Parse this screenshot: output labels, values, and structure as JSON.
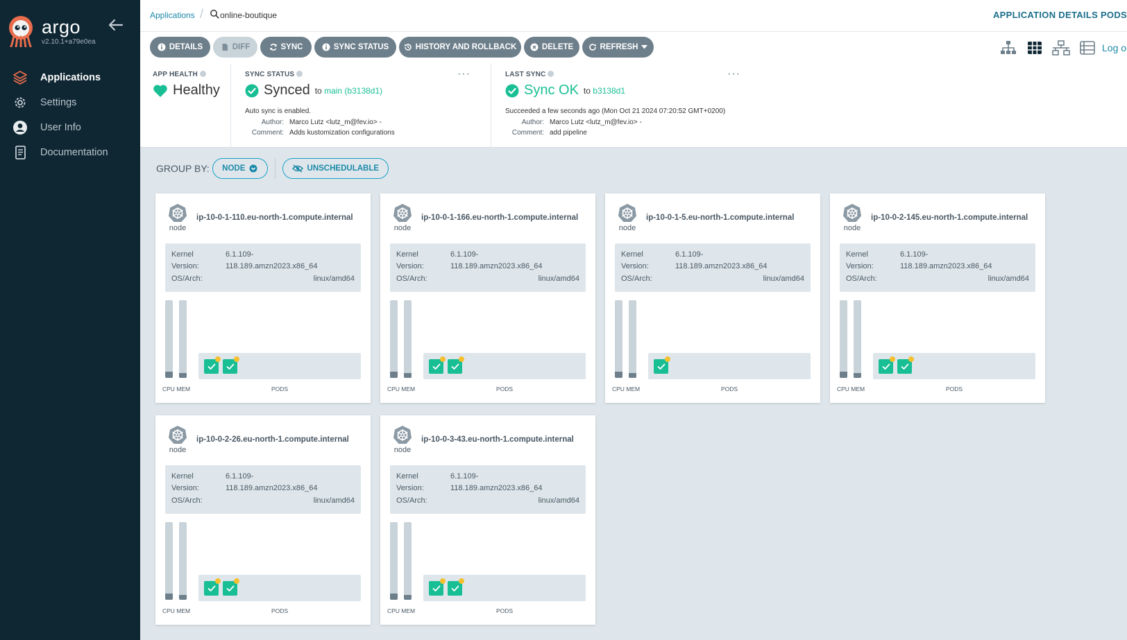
{
  "sidebar": {
    "brand": "argo",
    "version": "v2.10.1+a79e0ea",
    "items": [
      {
        "label": "Applications",
        "active": true
      },
      {
        "label": "Settings",
        "active": false
      },
      {
        "label": "User Info",
        "active": false
      },
      {
        "label": "Documentation",
        "active": false
      }
    ]
  },
  "topbar": {
    "breadcrumb": "Applications",
    "app_name": "online-boutique",
    "right_title": "APPLICATION DETAILS PODS"
  },
  "toolbar": {
    "details": "DETAILS",
    "diff": "DIFF",
    "sync": "SYNC",
    "sync_status": "SYNC STATUS",
    "history": "HISTORY AND ROLLBACK",
    "delete": "DELETE",
    "refresh": "REFRESH",
    "log_link": "Log out"
  },
  "status": {
    "app_health": {
      "title": "APP HEALTH",
      "value": "Healthy"
    },
    "sync_status": {
      "title": "SYNC STATUS",
      "value": "Synced",
      "to_prefix": "to",
      "to_target": "main (b3138d1)",
      "auto_sync": "Auto sync is enabled.",
      "author_label": "Author:",
      "author": "Marco Lutz <lutz_m@fev.io> -",
      "comment_label": "Comment:",
      "comment": "Adds kustomization configurations"
    },
    "last_sync": {
      "title": "LAST SYNC",
      "value": "Sync OK",
      "to_prefix": "to",
      "to_target": "b3138d1",
      "succeeded": "Succeeded a few seconds ago (Mon Oct 21 2024 07:20:52 GMT+0200)",
      "author_label": "Author:",
      "author": "Marco Lutz <lutz_m@fev.io> -",
      "comment_label": "Comment:",
      "comment": "add pipeline"
    },
    "more": "···"
  },
  "groupby": {
    "label": "GROUP BY:",
    "node": "NODE",
    "unschedulable": "UNSCHEDULABLE"
  },
  "nodes": [
    {
      "name": "ip-10-0-1-110.eu-north-1.compute.internal",
      "label": "node",
      "kernel_label": "Kernel",
      "kernel": "6.1.109-",
      "version_label": "Version:",
      "version": "118.189.amzn2023.x86_64",
      "osarch_label": "OS/Arch:",
      "osarch": "linux/amd64",
      "cpu_label": "CPU MEM",
      "pods_label": "PODS",
      "pods": 2,
      "cpu": 0.08,
      "mem": 0.0
    },
    {
      "name": "ip-10-0-1-166.eu-north-1.compute.internal",
      "label": "node",
      "kernel_label": "Kernel",
      "kernel": "6.1.109-",
      "version_label": "Version:",
      "version": "118.189.amzn2023.x86_64",
      "osarch_label": "OS/Arch:",
      "osarch": "linux/amd64",
      "cpu_label": "CPU MEM",
      "pods_label": "PODS",
      "pods": 2,
      "cpu": 0.08,
      "mem": 0.0
    },
    {
      "name": "ip-10-0-1-5.eu-north-1.compute.internal",
      "label": "node",
      "kernel_label": "Kernel",
      "kernel": "6.1.109-",
      "version_label": "Version:",
      "version": "118.189.amzn2023.x86_64",
      "osarch_label": "OS/Arch:",
      "osarch": "linux/amd64",
      "cpu_label": "CPU MEM",
      "pods_label": "PODS",
      "pods": 1,
      "cpu": 0.08,
      "mem": 0.0
    },
    {
      "name": "ip-10-0-2-145.eu-north-1.compute.internal",
      "label": "node",
      "kernel_label": "Kernel",
      "kernel": "6.1.109-",
      "version_label": "Version:",
      "version": "118.189.amzn2023.x86_64",
      "osarch_label": "OS/Arch:",
      "osarch": "linux/amd64",
      "cpu_label": "CPU MEM",
      "pods_label": "PODS",
      "pods": 2,
      "cpu": 0.08,
      "mem": 0.0
    },
    {
      "name": "ip-10-0-2-26.eu-north-1.compute.internal",
      "label": "node",
      "kernel_label": "Kernel",
      "kernel": "6.1.109-",
      "version_label": "Version:",
      "version": "118.189.amzn2023.x86_64",
      "osarch_label": "OS/Arch:",
      "osarch": "linux/amd64",
      "cpu_label": "CPU MEM",
      "pods_label": "PODS",
      "pods": 2,
      "cpu": 0.08,
      "mem": 0.0
    },
    {
      "name": "ip-10-0-3-43.eu-north-1.compute.internal",
      "label": "node",
      "kernel_label": "Kernel",
      "kernel": "6.1.109-",
      "version_label": "Version:",
      "version": "118.189.amzn2023.x86_64",
      "osarch_label": "OS/Arch:",
      "osarch": "linux/amd64",
      "cpu_label": "CPU MEM",
      "pods_label": "PODS",
      "pods": 2,
      "cpu": 0.08,
      "mem": 0.0
    }
  ],
  "colors": {
    "sidebar_bg": "#0f2733",
    "accent_green": "#18be94",
    "accent_blue": "#1b89a8",
    "button_gray": "#6d7f8b",
    "pod_pending_dot": "#f4c030"
  },
  "icons": {
    "details": "info-icon",
    "diff": "file-icon",
    "sync": "sync-icon",
    "sync_status": "info-icon",
    "history": "history-icon",
    "delete": "times-circle-icon",
    "refresh": "redo-icon"
  }
}
